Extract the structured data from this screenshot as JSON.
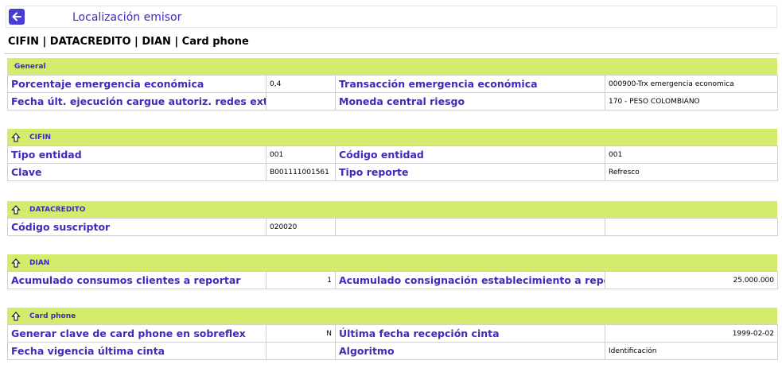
{
  "header": {
    "title": "Localización emisor",
    "subtitle": "CIFIN | DATACREDITO | DIAN | Card phone"
  },
  "sections": {
    "general": {
      "title": "General",
      "rows": [
        {
          "l1": "Porcentaje emergencia económica",
          "v1": "0,4",
          "l2": "Transacción emergencia económica",
          "v2": "000900-Trx emergencia economica"
        },
        {
          "l1": "Fecha últ. ejecución cargue autoriz. redes externas",
          "v1": "",
          "l2": "Moneda central riesgo",
          "v2": "170 - PESO COLOMBIANO"
        }
      ]
    },
    "cifin": {
      "title": "CIFIN",
      "rows": [
        {
          "l1": "Tipo entidad",
          "v1": "001",
          "l2": "Código entidad",
          "v2": "001"
        },
        {
          "l1": "Clave",
          "v1": "B001111001561",
          "l2": "Tipo reporte",
          "v2": "Refresco"
        }
      ]
    },
    "datacredito": {
      "title": "DATACREDITO",
      "rows": [
        {
          "l1": "Código suscriptor",
          "v1": "020020",
          "l2": "",
          "v2": ""
        }
      ]
    },
    "dian": {
      "title": "DIAN",
      "rows": [
        {
          "l1": "Acumulado consumos clientes a reportar",
          "v1": "1",
          "l2": "Acumulado consignación establecimiento a reportar",
          "v2": "25.000.000"
        }
      ]
    },
    "cardphone": {
      "title": "Card phone",
      "rows": [
        {
          "l1": "Generar clave de card phone en sobreflex",
          "v1": "N",
          "l2": "Última fecha recepción cinta",
          "v2": "1999-02-02"
        },
        {
          "l1": "Fecha vigencia última cinta",
          "v1": "",
          "l2": "Algoritmo",
          "v2": "Identificación"
        }
      ]
    }
  },
  "icons": {
    "back": "arrow-left-icon",
    "collapse": "arrow-up-icon"
  },
  "colors": {
    "accent": "#3c2bbd",
    "section_header": "#d4ec6e",
    "back_button": "#4a3bd6"
  }
}
